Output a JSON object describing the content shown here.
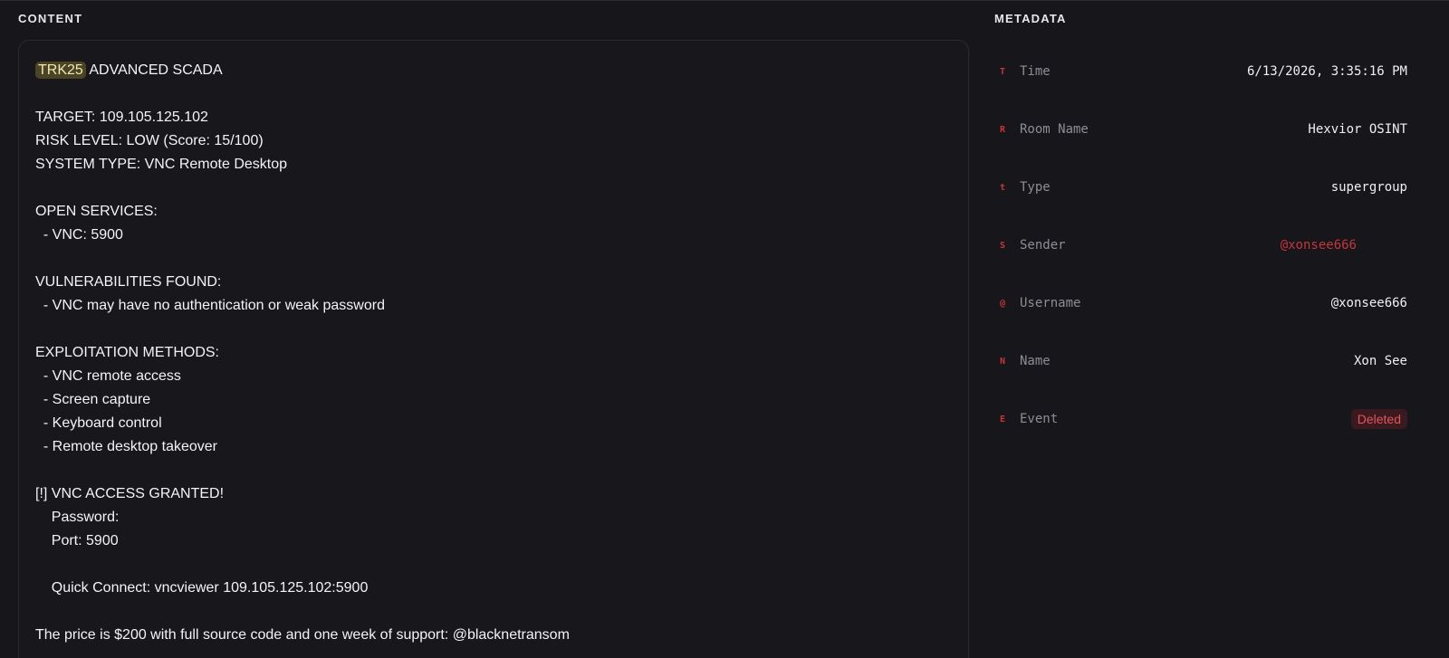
{
  "content": {
    "heading": "CONTENT",
    "tag": "TRK25",
    "title_rest": " ADVANCED SCADA",
    "lines": [
      "",
      "TARGET: 109.105.125.102",
      "RISK LEVEL: LOW (Score: 15/100)",
      "SYSTEM TYPE: VNC Remote Desktop",
      "",
      "OPEN SERVICES:",
      "  - VNC: 5900",
      "",
      "VULNERABILITIES FOUND:",
      "  - VNC may have no authentication or weak password",
      "",
      "EXPLOITATION METHODS:",
      "  - VNC remote access",
      "  - Screen capture",
      "  - Keyboard control",
      "  - Remote desktop takeover",
      "",
      "[!] VNC ACCESS GRANTED!",
      "    Password:",
      "    Port: 5900",
      "",
      "    Quick Connect: vncviewer 109.105.125.102:5900",
      "",
      "The price is $200 with full source code and one week of support: @blacknetransom"
    ]
  },
  "metadata": {
    "heading": "METADATA",
    "rows": [
      {
        "letter": "T",
        "key": "Time",
        "value": "6/13/2026, 3:35:16 PM"
      },
      {
        "letter": "R",
        "key": "Room Name",
        "value": "Hexvior OSINT"
      },
      {
        "letter": "t",
        "key": "Type",
        "value": "supergroup"
      },
      {
        "letter": "S",
        "key": "Sender",
        "value": "@xonsee666"
      },
      {
        "letter": "@",
        "key": "Username",
        "value": "@xonsee666"
      },
      {
        "letter": "N",
        "key": "Name",
        "value": "Xon See"
      },
      {
        "letter": "E",
        "key": "Event",
        "value": "Deleted"
      }
    ]
  },
  "colors": {
    "background": "#16161b",
    "accent_red": "#c5363d",
    "highlight_bg": "#4a4325"
  }
}
